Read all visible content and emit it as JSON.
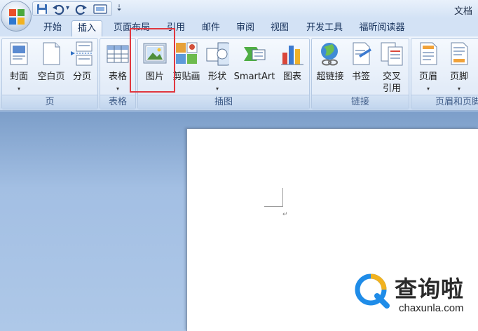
{
  "window": {
    "title": "文档"
  },
  "qat": {
    "save_icon": "save-icon",
    "undo_icon": "undo-icon",
    "redo_icon": "redo-icon",
    "customize_icon": "customize-icon",
    "dropdown_glyph": "▾",
    "menu_glyph": "⇣"
  },
  "tabs": [
    {
      "label": "开始"
    },
    {
      "label": "插入",
      "active": true
    },
    {
      "label": "页面布局"
    },
    {
      "label": "引用"
    },
    {
      "label": "邮件"
    },
    {
      "label": "审阅"
    },
    {
      "label": "视图"
    },
    {
      "label": "开发工具"
    },
    {
      "label": "福昕阅读器"
    }
  ],
  "ribbon": {
    "groups": {
      "pages": {
        "label": "页",
        "buttons": [
          {
            "label": "封面",
            "icon": "cover-page-icon",
            "dropdown": "▾"
          },
          {
            "label": "空白页",
            "icon": "blank-page-icon"
          },
          {
            "label": "分页",
            "icon": "page-break-icon"
          }
        ]
      },
      "tables": {
        "label": "表格",
        "buttons": [
          {
            "label": "表格",
            "icon": "table-icon",
            "dropdown": "▾"
          }
        ]
      },
      "illustrations": {
        "label": "插图",
        "buttons": [
          {
            "label": "图片",
            "icon": "picture-icon"
          },
          {
            "label": "剪贴画",
            "icon": "clip-art-icon"
          },
          {
            "label": "形状",
            "icon": "shapes-icon",
            "dropdown": "▾"
          },
          {
            "label": "SmartArt",
            "icon": "smartart-icon"
          },
          {
            "label": "图表",
            "icon": "chart-icon"
          }
        ]
      },
      "links": {
        "label": "链接",
        "buttons": [
          {
            "label": "超链接",
            "icon": "hyperlink-icon"
          },
          {
            "label": "书签",
            "icon": "bookmark-icon"
          },
          {
            "label": "交叉",
            "label2": "引用",
            "icon": "cross-reference-icon"
          }
        ]
      },
      "header_footer": {
        "label": "页眉和页脚",
        "buttons": [
          {
            "label": "页眉",
            "icon": "header-icon",
            "dropdown": "▾"
          },
          {
            "label": "页脚",
            "icon": "footer-icon",
            "dropdown": "▾"
          }
        ]
      }
    }
  },
  "document": {
    "paragraph_mark": "↵"
  },
  "watermark": {
    "text": "查询啦",
    "url": "chaxunla.com"
  },
  "colors": {
    "highlight_box": "#e0373f",
    "ribbon_bg": "#dfeaf8",
    "workspace_bg": "#a9c3e4",
    "accent_blue": "#1f8ce8"
  }
}
